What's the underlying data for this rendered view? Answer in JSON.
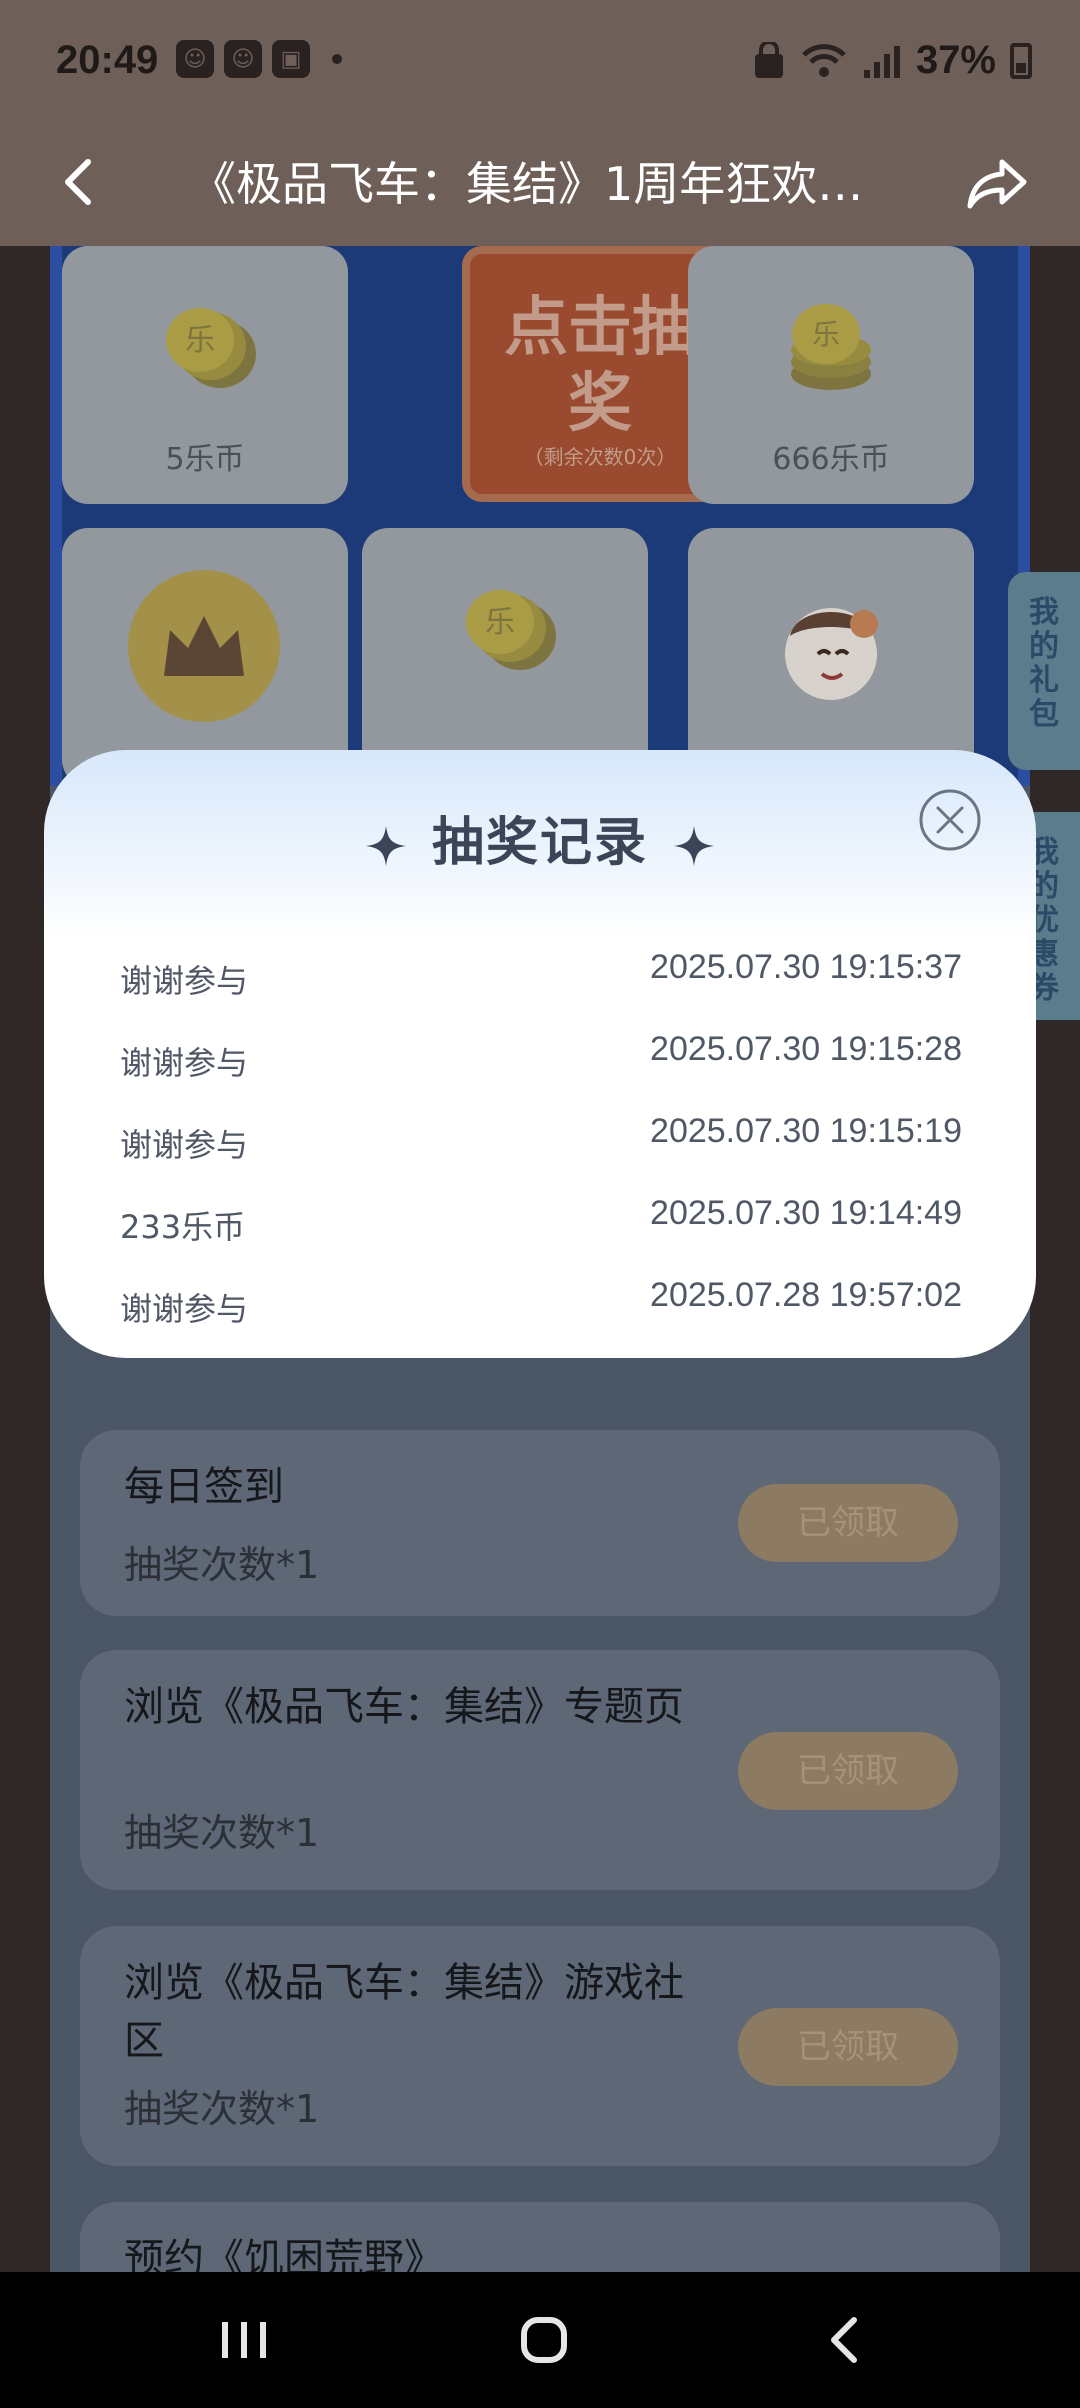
{
  "status_bar": {
    "time": "20:49",
    "battery": "37%"
  },
  "app_bar": {
    "title": "《极品飞车：集结》1周年狂欢，..."
  },
  "prize_grid": {
    "prizes": [
      {
        "label": "5乐币"
      },
      {
        "label": "666乐币"
      },
      {
        "label": ""
      },
      {
        "label": ""
      },
      {
        "label": ""
      }
    ],
    "draw_button": {
      "label": "点击抽奖",
      "remaining": "（剩余次数0次）"
    }
  },
  "side_tabs": [
    {
      "label": "我的礼包"
    },
    {
      "label": "我的优惠券"
    }
  ],
  "modal": {
    "title": "抽奖记录",
    "records": [
      {
        "prize": "谢谢参与",
        "time": "2025.07.30 19:15:37"
      },
      {
        "prize": "谢谢参与",
        "time": "2025.07.30 19:15:28"
      },
      {
        "prize": "谢谢参与",
        "time": "2025.07.30 19:15:19"
      },
      {
        "prize": "233乐币",
        "time": "2025.07.30 19:14:49"
      },
      {
        "prize": "谢谢参与",
        "time": "2025.07.28 19:57:02"
      }
    ]
  },
  "tasks": [
    {
      "name": "每日签到",
      "reward": "抽奖次数*1",
      "button": "已领取"
    },
    {
      "name": "浏览《极品飞车：集结》专题页",
      "reward": "抽奖次数*1",
      "button": "已领取"
    },
    {
      "name": "浏览《极品飞车：集结》游戏社区",
      "reward": "抽奖次数*1",
      "button": "已领取"
    },
    {
      "name": "预约《饥困荒野》",
      "reward": "",
      "button": ""
    }
  ]
}
